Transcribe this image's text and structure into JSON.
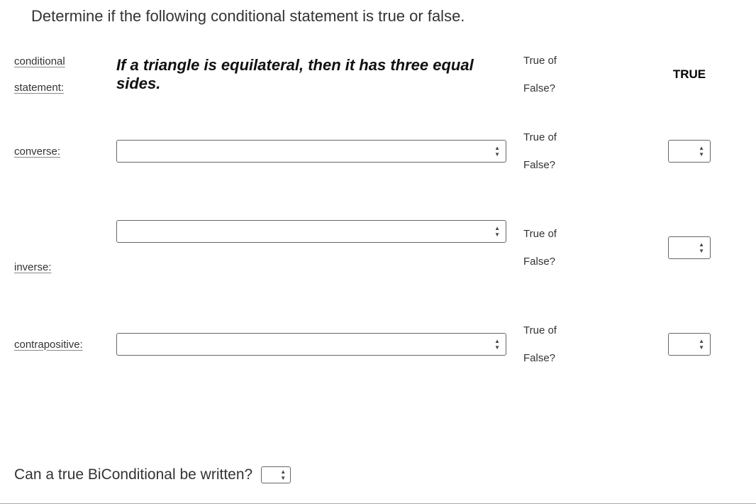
{
  "question": "Determine if the following conditional statement is true or false.",
  "labels": {
    "conditional": "conditional",
    "statement": "statement:",
    "converse": "converse:",
    "inverse": "inverse:",
    "contrapositive": "contrapositive:"
  },
  "conditional_text": "If a triangle is equilateral, then it has three equal sides.",
  "truefalse": {
    "line1": "True of",
    "line2": "False?"
  },
  "answer_true": "TRUE",
  "biconditional": "Can a true BiConditional be written?"
}
